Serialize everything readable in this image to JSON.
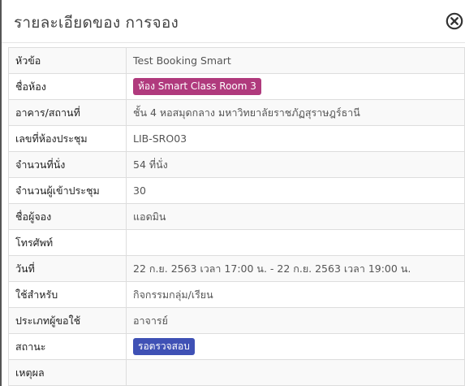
{
  "modal": {
    "title": "รายละเอียดของ การจอง",
    "close_icon": "close-circle-icon"
  },
  "rows": [
    {
      "label": "หัวข้อ",
      "value": "Test Booking Smart",
      "type": "text"
    },
    {
      "label": "ชื่อห้อง",
      "value": "ห้อง Smart Class Room 3",
      "type": "badge",
      "color": "#b03a7d"
    },
    {
      "label": "อาคาร/สถานที่",
      "value": "ชั้น 4 หอสมุดกลาง มหาวิทยาลัยราชภัฏสุราษฎร์ธานี",
      "type": "text"
    },
    {
      "label": "เลขที่ห้องประชุม",
      "value": "LIB-SRO03",
      "type": "text"
    },
    {
      "label": "จำนวนที่นั่ง",
      "value": "54 ที่นั่ง",
      "type": "text"
    },
    {
      "label": "จำนวนผู้เข้าประชุม",
      "value": "30",
      "type": "text"
    },
    {
      "label": "ชื่อผู้จอง",
      "value": "แอดมิน",
      "type": "text"
    },
    {
      "label": "โทรศัพท์",
      "value": "",
      "type": "text"
    },
    {
      "label": "วันที่",
      "value": "22 ก.ย. 2563 เวลา 17:00 น. - 22 ก.ย. 2563 เวลา 19:00 น.",
      "type": "text"
    },
    {
      "label": "ใช้สำหรับ",
      "value": "กิจกรรมกลุ่ม/เรียน",
      "type": "text"
    },
    {
      "label": "ประเภทผู้ขอใช้",
      "value": "อาจารย์",
      "type": "text"
    },
    {
      "label": "สถานะ",
      "value": "รอตรวจสอบ",
      "type": "badge",
      "color": "#3f51b5"
    },
    {
      "label": "เหตุผล",
      "value": "",
      "type": "text"
    }
  ]
}
